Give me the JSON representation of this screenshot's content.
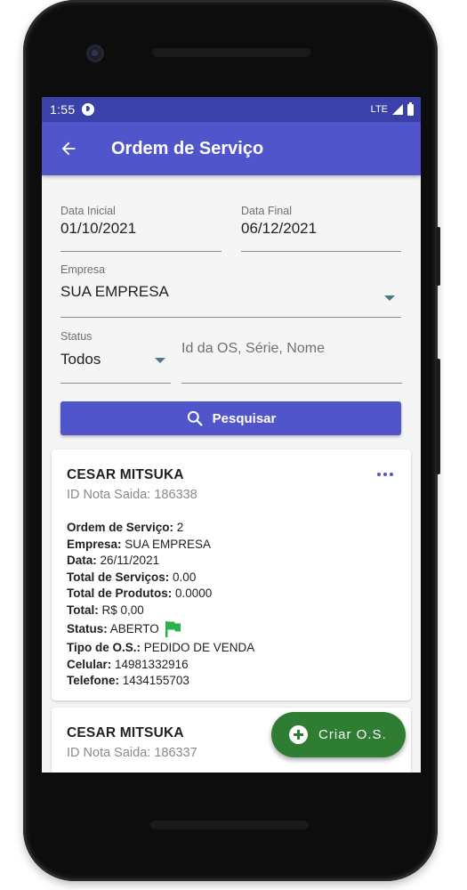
{
  "statusbar": {
    "time": "1:55",
    "network": "LTE"
  },
  "appbar": {
    "title": "Ordem de Serviço",
    "back_icon": "arrow-left-icon"
  },
  "filters": {
    "date_start_label": "Data Inicial",
    "date_start_value": "01/10/2021",
    "date_end_label": "Data Final",
    "date_end_value": "06/12/2021",
    "company_label": "Empresa",
    "company_value": "SUA EMPRESA",
    "status_label": "Status",
    "status_value": "Todos",
    "search_placeholder": "Id da OS, Série, Nome",
    "search_button": "Pesquisar"
  },
  "cards": [
    {
      "name": "CESAR MITSUKA",
      "subtitle": "ID Nota Saida: 186338",
      "details": {
        "os_label": "Ordem de Serviço:",
        "os_value": " 2",
        "company_label": "Empresa:",
        "company_value": " SUA EMPRESA",
        "date_label": "Data:",
        "date_value": " 26/11/2021",
        "services_label": "Total de Serviços:",
        "services_value": " 0.00",
        "products_label": "Total de Produtos:",
        "products_value": " 0.0000",
        "total_label": "Total:",
        "total_value": " R$ 0,00",
        "status_label": "Status:",
        "status_value": " ABERTO",
        "type_label": "Tipo de O.S.:",
        "type_value": " PEDIDO DE VENDA",
        "mobile_label": "Celular:",
        "mobile_value": " 14981332916",
        "phone_label": "Telefone:",
        "phone_value": " 1434155703"
      }
    },
    {
      "name": "CESAR MITSUKA",
      "subtitle": "ID Nota Saida: 186337"
    }
  ],
  "fab": {
    "label": "Criar O.S."
  },
  "colors": {
    "primary": "#5055cc",
    "statusbar": "#3a41a8",
    "fab": "#2e7d32",
    "flag": "#2bb24c"
  }
}
